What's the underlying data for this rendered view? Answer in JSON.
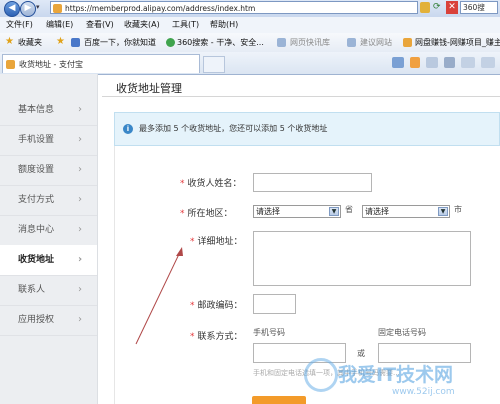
{
  "browser": {
    "url": "https://memberprod.alipay.com/address/index.htm",
    "search_engine": "360搜"
  },
  "menu": [
    "文件(F)",
    "编辑(E)",
    "查看(V)",
    "收藏夹(A)",
    "工具(T)",
    "帮助(H)"
  ],
  "favorites": {
    "label": "收藏夹",
    "items": [
      "百度一下，你就知道",
      "360搜索 - 干净、安全...",
      "网页快讯库",
      "建议网站",
      "网盘赚钱-网赚项目_赚主..."
    ]
  },
  "tab": {
    "title": "收货地址 - 支付宝"
  },
  "sidebar": {
    "items": [
      {
        "label": "基本信息"
      },
      {
        "label": "手机设置"
      },
      {
        "label": "额度设置"
      },
      {
        "label": "支付方式"
      },
      {
        "label": "消息中心"
      },
      {
        "label": "收货地址"
      },
      {
        "label": "联系人"
      },
      {
        "label": "应用授权"
      }
    ],
    "active_index": 5,
    "chevron": "›"
  },
  "page": {
    "title": "收货地址管理"
  },
  "notice": {
    "text": "最多添加 5 个收货地址，您还可以添加 5 个收货地址"
  },
  "form": {
    "name_label": "收货人姓名：",
    "region_label": "所在地区：",
    "province_value": "请选择",
    "province_suffix": "省",
    "city_value": "请选择",
    "city_suffix": "市",
    "address_label": "详细地址：",
    "zip_label": "邮政编码：",
    "contact_label": "联系方式：",
    "mobile_label": "手机号码",
    "phone_label": "固定电话号码",
    "or_text": "或",
    "hint": "手机和固定电话选填一项，其中手机号码需要..."
  },
  "watermark": {
    "title": "我爱IT技术网",
    "url": "www.52ij.com"
  },
  "colors": {
    "accent": "#f39b2a",
    "required": "#e4393c",
    "info": "#3a87c8"
  }
}
